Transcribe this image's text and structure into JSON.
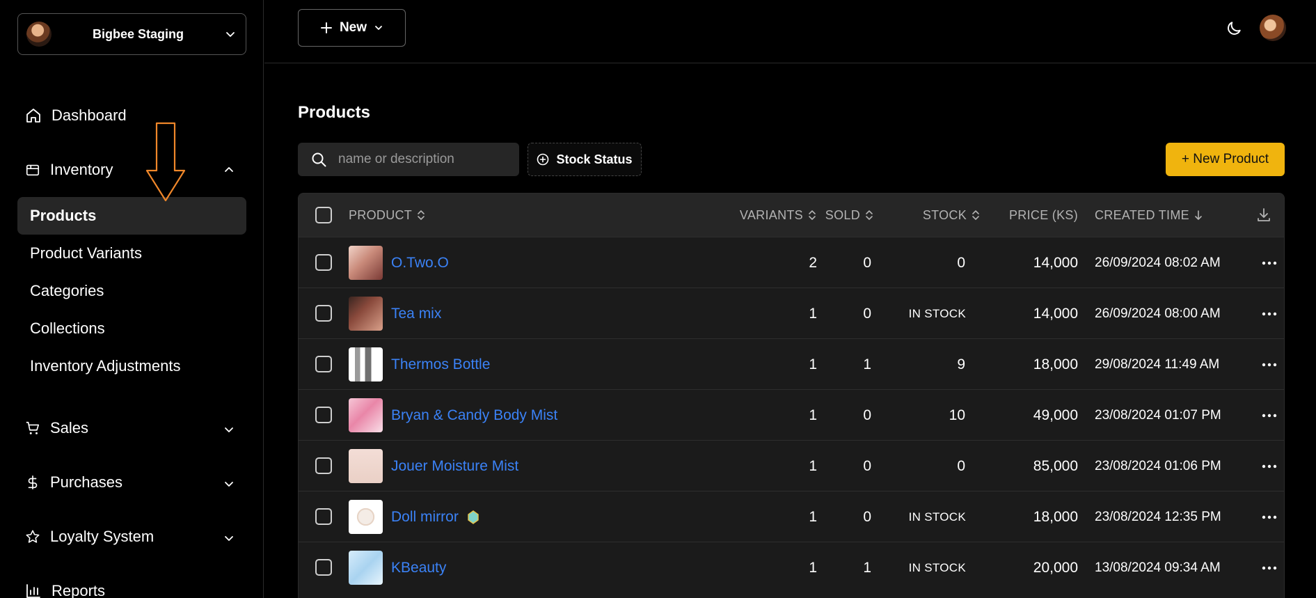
{
  "store": {
    "name": "Bigbee Staging"
  },
  "nav": {
    "dashboard": "Dashboard",
    "inventory": "Inventory",
    "inventory_items": [
      "Products",
      "Product Variants",
      "Categories",
      "Collections",
      "Inventory Adjustments"
    ],
    "sales": "Sales",
    "purchases": "Purchases",
    "loyalty": "Loyalty System",
    "reports": "Reports"
  },
  "topbar": {
    "new_label": "New"
  },
  "page": {
    "title": "Products",
    "search_placeholder": "name or description",
    "stock_filter_label": "Stock Status",
    "new_product_label": "+ New Product"
  },
  "table": {
    "headers": {
      "product": "PRODUCT",
      "variants": "VARIANTS",
      "sold": "SOLD",
      "stock": "STOCK",
      "price": "PRICE (KS)",
      "created": "CREATED TIME"
    },
    "rows": [
      {
        "name": "O.Two.O",
        "variants": "2",
        "sold": "0",
        "stock": "0",
        "price": "14,000",
        "created": "26/09/2024 08:02 AM"
      },
      {
        "name": "Tea mix",
        "variants": "1",
        "sold": "0",
        "stock": "IN STOCK",
        "price": "14,000",
        "created": "26/09/2024 08:00 AM"
      },
      {
        "name": "Thermos Bottle",
        "variants": "1",
        "sold": "1",
        "stock": "9",
        "price": "18,000",
        "created": "29/08/2024 11:49 AM"
      },
      {
        "name": "Bryan & Candy Body Mist",
        "variants": "1",
        "sold": "0",
        "stock": "10",
        "price": "49,000",
        "created": "23/08/2024 01:07 PM"
      },
      {
        "name": "Jouer Moisture Mist",
        "variants": "1",
        "sold": "0",
        "stock": "0",
        "price": "85,000",
        "created": "23/08/2024 01:06 PM"
      },
      {
        "name": "Doll mirror",
        "variants": "1",
        "sold": "0",
        "stock": "IN STOCK",
        "price": "18,000",
        "created": "23/08/2024 12:35 PM"
      },
      {
        "name": "KBeauty",
        "variants": "1",
        "sold": "1",
        "stock": "IN STOCK",
        "price": "20,000",
        "created": "13/08/2024 09:34 AM"
      }
    ]
  },
  "colors": {
    "accent": "#f0b40e",
    "link": "#3b82f6",
    "annotation": "#f0872a"
  }
}
